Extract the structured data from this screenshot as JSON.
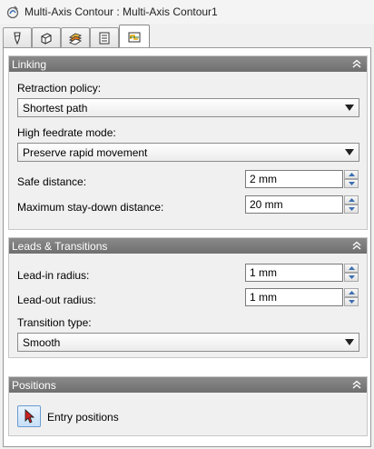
{
  "window": {
    "title": "Multi-Axis Contour : Multi-Axis Contour1",
    "title_icon": "operation-icon"
  },
  "tabs": [
    {
      "name": "tool",
      "icon": "tool-icon"
    },
    {
      "name": "geometry",
      "icon": "geometry-icon"
    },
    {
      "name": "heights",
      "icon": "heights-icon"
    },
    {
      "name": "passes",
      "icon": "passes-icon"
    },
    {
      "name": "linking",
      "icon": "linking-icon",
      "active": true
    }
  ],
  "linking": {
    "header": "Linking",
    "retraction_policy_label": "Retraction policy:",
    "retraction_policy_value": "Shortest path",
    "high_feedrate_label": "High feedrate mode:",
    "high_feedrate_value": "Preserve rapid movement",
    "safe_distance_label": "Safe distance:",
    "safe_distance_value": "2 mm",
    "max_staydown_label": "Maximum stay-down distance:",
    "max_staydown_value": "20 mm"
  },
  "leads": {
    "header": "Leads & Transitions",
    "lead_in_label": "Lead-in radius:",
    "lead_in_value": "1 mm",
    "lead_out_label": "Lead-out radius:",
    "lead_out_value": "1 mm",
    "transition_type_label": "Transition type:",
    "transition_type_value": "Smooth"
  },
  "positions": {
    "header": "Positions",
    "entry_positions_label": "Entry positions"
  },
  "colors": {
    "group_header": "#7d7d7d",
    "panel_bg": "#f0f0f0",
    "button_blue": "#c7dff7"
  }
}
